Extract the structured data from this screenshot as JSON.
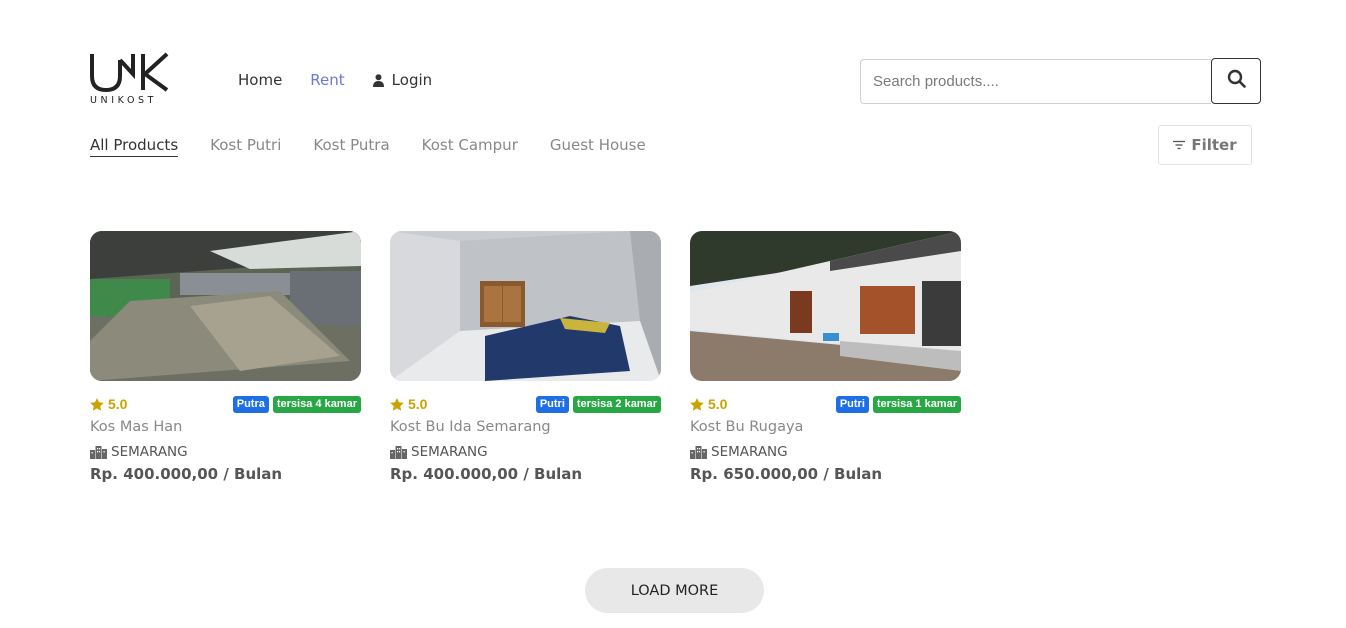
{
  "brand": {
    "logo_text": "UNIKOST"
  },
  "nav": {
    "home": "Home",
    "rent": "Rent",
    "login": "Login"
  },
  "search": {
    "placeholder": "Search products...."
  },
  "categories": [
    {
      "label": "All Products",
      "active": true
    },
    {
      "label": "Kost Putri",
      "active": false
    },
    {
      "label": "Kost Putra",
      "active": false
    },
    {
      "label": "Kost Campur",
      "active": false
    },
    {
      "label": "Guest House",
      "active": false
    }
  ],
  "filter": {
    "label": "Filter"
  },
  "products": [
    {
      "rating": "5.0",
      "type": "Putra",
      "availability": "tersisa 4 kamar",
      "name": "Kos Mas Han",
      "city": "SEMARANG",
      "price": "Rp. 400.000,00 / Bulan"
    },
    {
      "rating": "5.0",
      "type": "Putri",
      "availability": "tersisa 2 kamar",
      "name": "Kost Bu Ida Semarang",
      "city": "SEMARANG",
      "price": "Rp. 400.000,00 / Bulan"
    },
    {
      "rating": "5.0",
      "type": "Putri",
      "availability": "tersisa 1 kamar",
      "name": "Kost Bu Rugaya",
      "city": "SEMARANG",
      "price": "Rp. 650.000,00 / Bulan"
    }
  ],
  "load_more": {
    "label": "LOAD MORE"
  },
  "colors": {
    "accent": "#6b76e0",
    "rating": "#c9a300",
    "badge_type": "#1e6fe6",
    "badge_room": "#28a745"
  }
}
